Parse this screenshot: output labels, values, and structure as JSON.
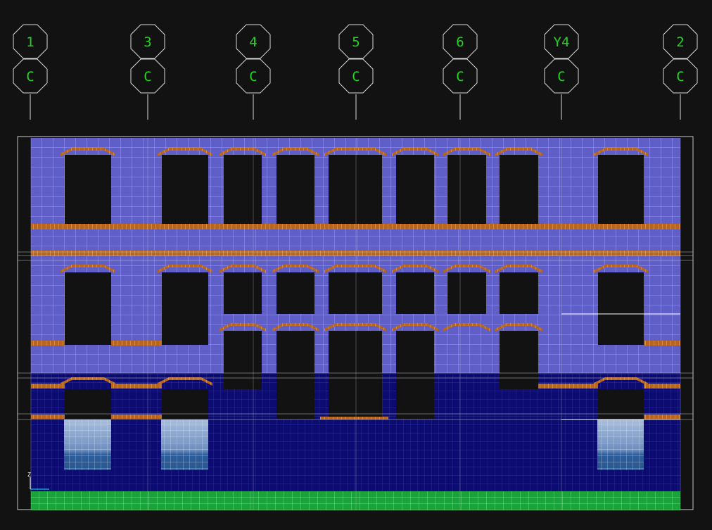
{
  "view": {
    "background": "#121212",
    "grid_line_color": "#bdbdbd",
    "bubble_text_color": "#22d422",
    "bubble_stroke_color": "#d8d8d8"
  },
  "grid_bubbles": [
    {
      "id": "1",
      "sub": "C"
    },
    {
      "id": "3",
      "sub": "C"
    },
    {
      "id": "4",
      "sub": "C"
    },
    {
      "id": "5",
      "sub": "C"
    },
    {
      "id": "6",
      "sub": "C"
    },
    {
      "id": "Y4",
      "sub": "C"
    },
    {
      "id": "2",
      "sub": "C"
    }
  ],
  "axis_triad": {
    "label": "Z"
  },
  "colors": {
    "upper_wall": "#5f5fc7",
    "upper_mesh": "#b9b9ff",
    "lower_wall": "#0b0b72",
    "lower_mesh": "#3434b4",
    "beam": "#b8661e",
    "beam_mesh": "#f0c27a",
    "foundation": "#1aa33a",
    "foundation_mesh": "#8ff0a6",
    "panel_top": "#9ab0d2",
    "panel_bottom": "#2f5e9c"
  }
}
